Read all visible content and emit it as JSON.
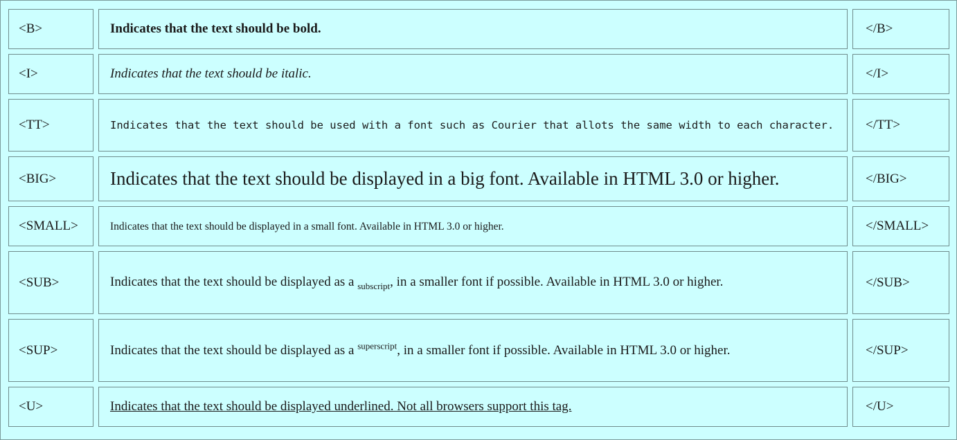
{
  "rows": [
    {
      "open": "<B>",
      "close": "</B>",
      "desc": "Indicates that the text should be bold."
    },
    {
      "open": "<I>",
      "close": "</I>",
      "desc": "Indicates that the text should be italic."
    },
    {
      "open": "<TT>",
      "close": "</TT>",
      "desc": "Indicates that the text should be used with a font such as Courier that allots the same width to each character."
    },
    {
      "open": "<BIG>",
      "close": "</BIG>",
      "desc": "Indicates that the text should be displayed in a big font. Available in HTML 3.0 or higher."
    },
    {
      "open": "<SMALL>",
      "close": "</SMALL>",
      "desc": "Indicates that the text should be displayed in a small font. Available in HTML 3.0 or higher."
    },
    {
      "open": "<SUB>",
      "close": "</SUB>",
      "desc_pre": "Indicates that the text should be displayed as a ",
      "desc_mark": "subscript",
      "desc_post": ", in a smaller font if possible. Available in HTML 3.0 or higher."
    },
    {
      "open": "<SUP>",
      "close": "</SUP>",
      "desc_pre": "Indicates that the text should be displayed as a ",
      "desc_mark": "superscript",
      "desc_post": ", in a smaller font if possible. Available in HTML 3.0 or higher."
    },
    {
      "open": "<U>",
      "close": "</U>",
      "desc": "Indicates that the text should be displayed underlined. Not all browsers support this tag."
    }
  ],
  "colors": {
    "background": "#ccffff",
    "border": "#6f8c8c",
    "text": "#1a1a1a"
  }
}
